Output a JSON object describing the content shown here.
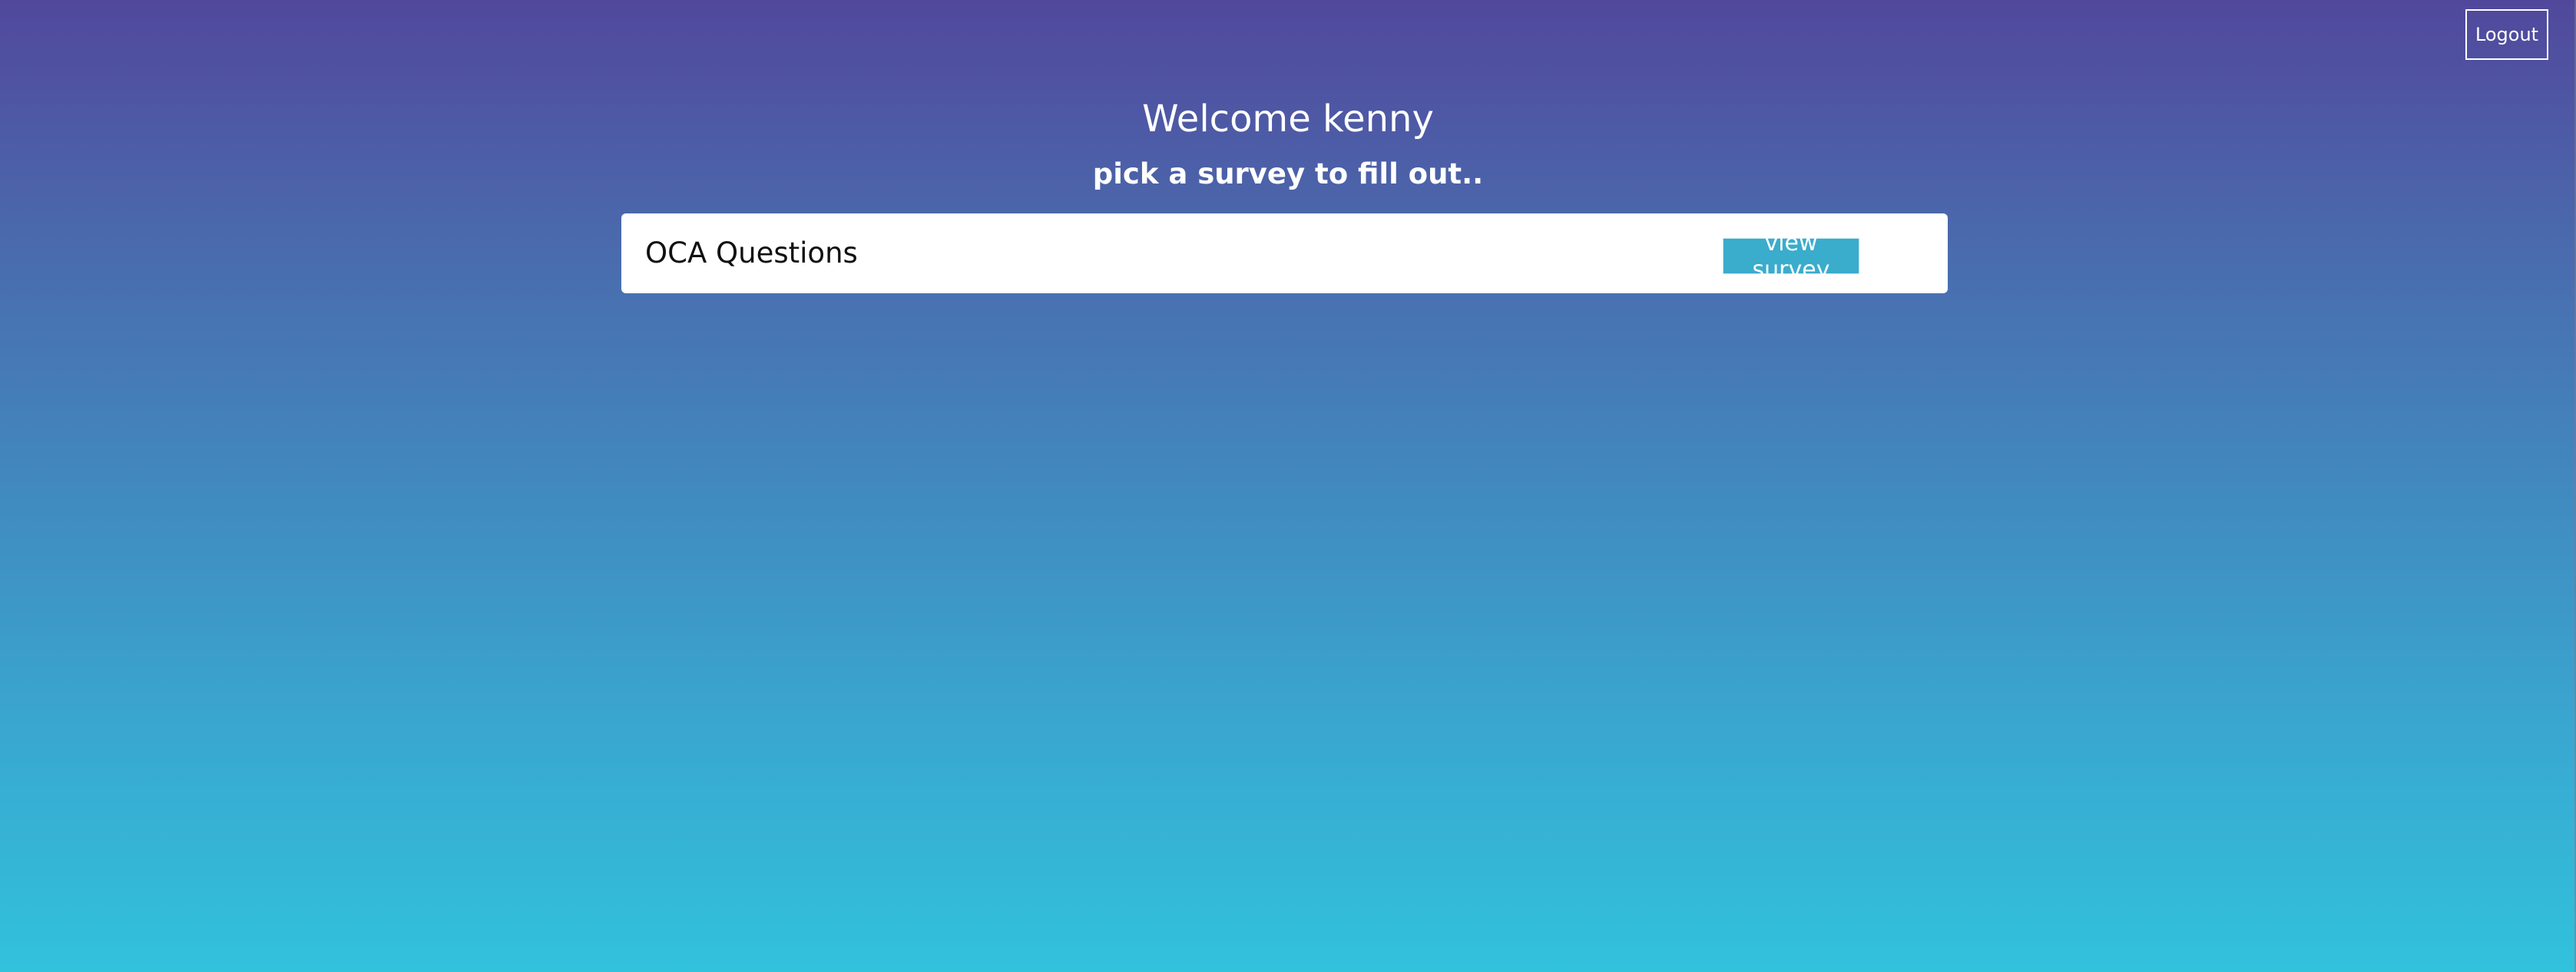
{
  "header": {
    "logout_label": "Logout"
  },
  "welcome": {
    "title": "Welcome kenny",
    "subtitle": "pick a survey to fill out.."
  },
  "surveys": [
    {
      "name": "OCA Questions",
      "action_label": "view survey"
    }
  ],
  "colors": {
    "gradient_top": "#51489c",
    "gradient_bottom": "#31c2dc",
    "button_accent": "#3aaccc",
    "card_background": "#ffffff"
  }
}
